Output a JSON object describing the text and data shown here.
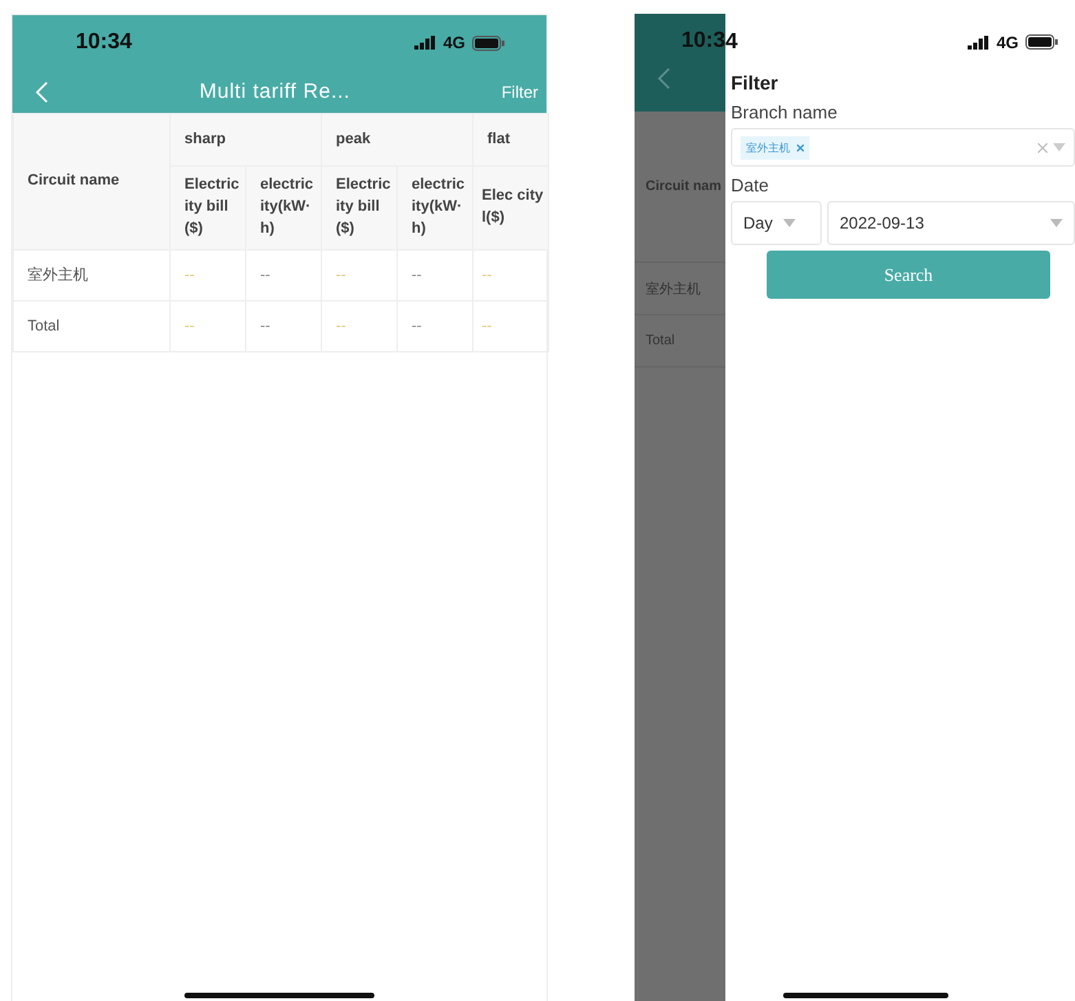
{
  "report_screen": {
    "status_bar": {
      "time": "10:34",
      "network": "4G"
    },
    "nav_bar": {
      "title": "Multi tariff Re...",
      "action": "Filter"
    },
    "table": {
      "corner": "Circuit name",
      "groups": [
        {
          "label": "sharp"
        },
        {
          "label": "peak"
        },
        {
          "label": "flat"
        }
      ],
      "columns": [
        {
          "label": "Electricity bill($)",
          "kind": "bill"
        },
        {
          "label": "electricity(kW·h)",
          "kind": "energy"
        },
        {
          "label": "Electricity bill($)",
          "kind": "bill"
        },
        {
          "label": "electricity(kW·h)",
          "kind": "energy"
        },
        {
          "label": "Elec city l($)",
          "kind": "bill"
        }
      ],
      "rows": [
        {
          "name": "室外主机",
          "values": [
            "--",
            "--",
            "--",
            "--",
            "--"
          ]
        },
        {
          "name": "Total",
          "values": [
            "--",
            "--",
            "--",
            "--",
            "--"
          ]
        }
      ]
    }
  },
  "filter_screen": {
    "background": {
      "time": "10:3",
      "circuit_header": "Circuit nam",
      "rows": [
        "室外主机",
        "Total"
      ]
    },
    "drawer": {
      "time": "4",
      "network": "4G",
      "title": "Filter",
      "branch_label": "Branch name",
      "branch_tags": [
        "室外主机"
      ],
      "date_label": "Date",
      "period": "Day",
      "date": "2022-09-13",
      "search_button": "Search"
    }
  }
}
